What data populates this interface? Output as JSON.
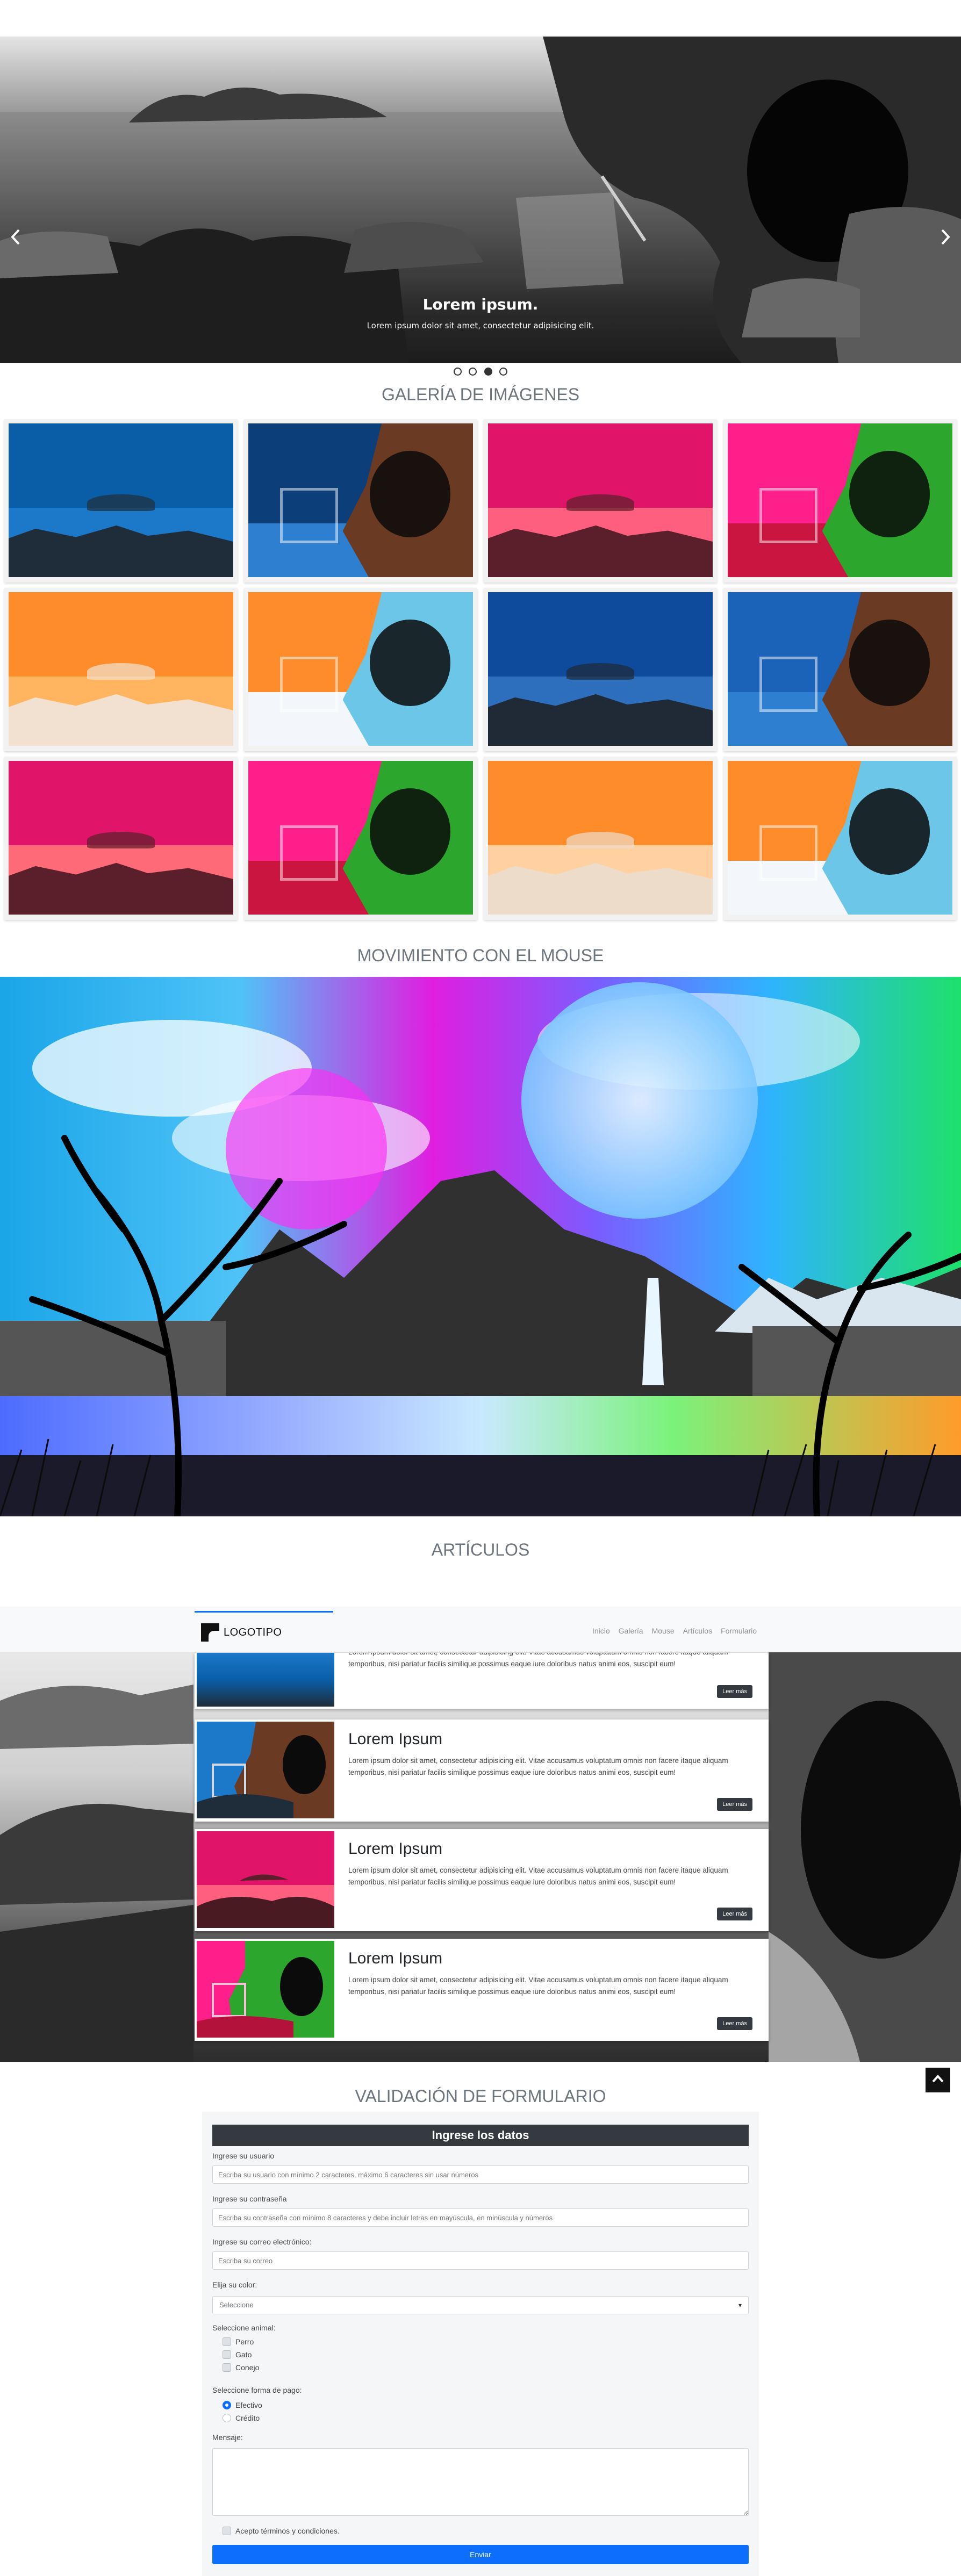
{
  "carousel": {
    "prev_icon": "chevron-left-icon",
    "next_icon": "chevron-right-icon",
    "caption_title": "Lorem ipsum.",
    "caption_text": "Lorem ipsum dolor sit amet, consectetur adipisicing elit.",
    "slides_count": 4,
    "active_slide": 3
  },
  "gallery": {
    "title": "GALERÍA DE IMÁGENES",
    "items": [
      {
        "scene": "sea",
        "sky": "#0a5ea8",
        "sea": "#1c78c9",
        "rock": "#1f2d3a"
      },
      {
        "scene": "cave",
        "sky": "#0c3e7a",
        "sea": "#2f7fd0",
        "rock": "#6b3a22"
      },
      {
        "scene": "sea",
        "sky": "#e0156a",
        "sea": "#ff5f7f",
        "rock": "#5a1f2a"
      },
      {
        "scene": "cave",
        "sky": "#ff1f8a",
        "sea": "#c9153f",
        "rock": "#2da62d"
      },
      {
        "scene": "sea",
        "sky": "#ff8c2a",
        "sea": "#ffb55f",
        "rock": "#f2e1d0"
      },
      {
        "scene": "cave",
        "sky": "#ff8c2a",
        "sea": "#f3f7fb",
        "rock": "#6bc6e8"
      },
      {
        "scene": "sea",
        "sky": "#0f4b9c",
        "sea": "#2e6fbd",
        "rock": "#1f2a36"
      },
      {
        "scene": "cave",
        "sky": "#1a63b8",
        "sea": "#2f7fd0",
        "rock": "#6b3a22"
      },
      {
        "scene": "sea",
        "sky": "#e0156a",
        "sea": "#ff6a78",
        "rock": "#5a1f2a"
      },
      {
        "scene": "cave",
        "sky": "#ff1f8a",
        "sea": "#c9153f",
        "rock": "#2da62d"
      },
      {
        "scene": "sea",
        "sky": "#ff8c2a",
        "sea": "#ffd0a0",
        "rock": "#eedccb"
      },
      {
        "scene": "cave",
        "sky": "#ff8c2a",
        "sea": "#f3f7fb",
        "rock": "#6bc6e8"
      }
    ]
  },
  "mouse": {
    "title": "MOVIMIENTO CON EL MOUSE"
  },
  "articles": {
    "title": "ARTÍCULOS",
    "navbar": {
      "logo_text": "LOGOTIPO",
      "links": [
        "Inicio",
        "Galería",
        "Mouse",
        "Artículos",
        "Formulario"
      ]
    },
    "partial_text": "Lorem ipsum dolor sit amet, consectetur adipisicing elit. Vitae accusamus voluptatum omnis non facere itaque aliquam temporibus, nisi pariatur facilis similique possimus eaque iure doloribus natus animi eos, suscipit eum!",
    "items": [
      {
        "title": "Lorem Ipsum",
        "text": "Lorem ipsum dolor sit amet, consectetur adipisicing elit. Vitae accusamus voluptatum omnis non facere itaque aliquam temporibus, nisi pariatur facilis similique possimus eaque iure doloribus natus animi eos, suscipit eum!",
        "button": "Leer más"
      },
      {
        "title": "Lorem Ipsum",
        "text": "Lorem ipsum dolor sit amet, consectetur adipisicing elit. Vitae accusamus voluptatum omnis non facere itaque aliquam temporibus, nisi pariatur facilis similique possimus eaque iure doloribus natus animi eos, suscipit eum!",
        "button": "Leer más"
      },
      {
        "title": "Lorem Ipsum",
        "text": "Lorem ipsum dolor sit amet, consectetur adipisicing elit. Vitae accusamus voluptatum omnis non facere itaque aliquam temporibus, nisi pariatur facilis similique possimus eaque iure doloribus natus animi eos, suscipit eum!",
        "button": "Leer más"
      }
    ],
    "partial_button": "Leer más",
    "back_to_top_icon": "chevron-up-icon"
  },
  "form": {
    "title": "VALIDACIÓN DE FORMULARIO",
    "header": "Ingrese los datos",
    "user_label": "Ingrese su usuario",
    "user_placeholder": "Escriba su usuario con mínimo 2 caracteres, máximo 6 caracteres sin usar números",
    "password_label": "Ingrese su contraseña",
    "password_placeholder": "Escriba su contraseña con mínimo 8 caracteres y debe incluir letras en mayúscula, en minúscula y números",
    "email_label": "Ingrese su correo electrónico:",
    "email_placeholder": "Escriba su correo",
    "color_label": "Elija su color:",
    "color_selected": "Seleccione",
    "animal_label": "Seleccione animal:",
    "animals": [
      "Perro",
      "Gato",
      "Conejo"
    ],
    "payment_label": "Seleccione forma de pago:",
    "payments": [
      "Efectivo",
      "Crédito"
    ],
    "payment_selected": "Efectivo",
    "message_label": "Mensaje:",
    "terms_label": "Acepto términos y condiciones.",
    "submit": "Enviar"
  }
}
